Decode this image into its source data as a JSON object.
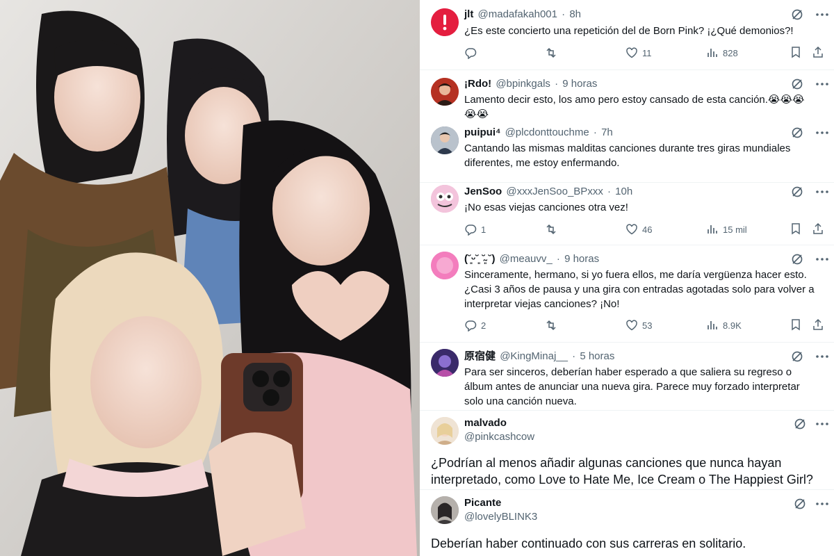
{
  "tweets": [
    {
      "name": "jlt",
      "handle": "@madafakah001",
      "time": "8h",
      "text": "¿Es este concierto una repetición del de Born Pink? ¡¿Qué demonios?!",
      "replies": "",
      "likes": "11",
      "views": "828",
      "avatar_color": "#e0245e"
    },
    {
      "name": "¡Rdo!",
      "handle": "@bpinkgals",
      "time": "9 horas",
      "text_line1": "Lamento decir esto, los amo pero estoy cansado de esta canción.😭😭😭",
      "text_line2": "😭😭",
      "avatar_color": "#c1331f"
    },
    {
      "name": "puipui⁴",
      "handle": "@plcdonttouchme",
      "time": "7h",
      "text_line1": "Cantando las mismas malditas canciones durante tres giras mundiales",
      "text_line2": "diferentes, me estoy enfermando.",
      "avatar_color": "#3b4a5c"
    },
    {
      "name": "JenSoo",
      "handle": "@xxxJenSoo_BPxxx",
      "time": "10h",
      "text": "¡No esas viejas canciones otra vez!",
      "replies": "1",
      "likes": "46",
      "views": "15 mil",
      "avatar_color": "#e8a6c8"
    },
    {
      "name": "(˘͈ᵕ˘͈ ˘̴͈ ˘)",
      "name_display": "(˘͈ᵕ˘͈)",
      "handle": "@meauvv_",
      "time": "9 horas",
      "text_line1": "Sinceramente, hermano, si yo fuera ellos, me daría vergüenza hacer esto.",
      "text_line2": "¿Casi 3 años de pausa y una gira con entradas agotadas solo para volver a",
      "text_line3": "interpretar viejas canciones? ¡No!",
      "replies": "2",
      "likes": "53",
      "views": "8.9K",
      "avatar_color": "#f06ab0"
    },
    {
      "name": "原宿健",
      "handle": "@KingMinaj__",
      "time": "5 horas",
      "text_line1": "Para ser sinceros, deberían haber esperado a que saliera su regreso o",
      "text_line2": "álbum antes de anunciar una nueva gira. Parece muy forzado interpretar",
      "text_line3": "solo una canción nueva.",
      "avatar_color": "#5a3e8c"
    },
    {
      "name": "malvado",
      "handle": "@pinkcashcow",
      "text_line1": "¿Podrían al menos añadir algunas canciones que nunca hayan",
      "text_line2": "interpretado, como Love to Hate Me, Ice Cream o The Happiest Girl?",
      "avatar_color": "#e9d2b8"
    },
    {
      "name": "Picante",
      "handle": "@lovelyBLINK3",
      "text": "Deberían haber continuado con sus carreras en solitario.",
      "avatar_color": "#8a8a8a"
    }
  ],
  "icons": {
    "reply": "reply-icon",
    "retweet": "retweet-icon",
    "like": "like-icon",
    "views": "views-icon",
    "bookmark": "bookmark-icon",
    "share": "share-icon",
    "grok": "grok-icon",
    "more": "more-icon"
  }
}
